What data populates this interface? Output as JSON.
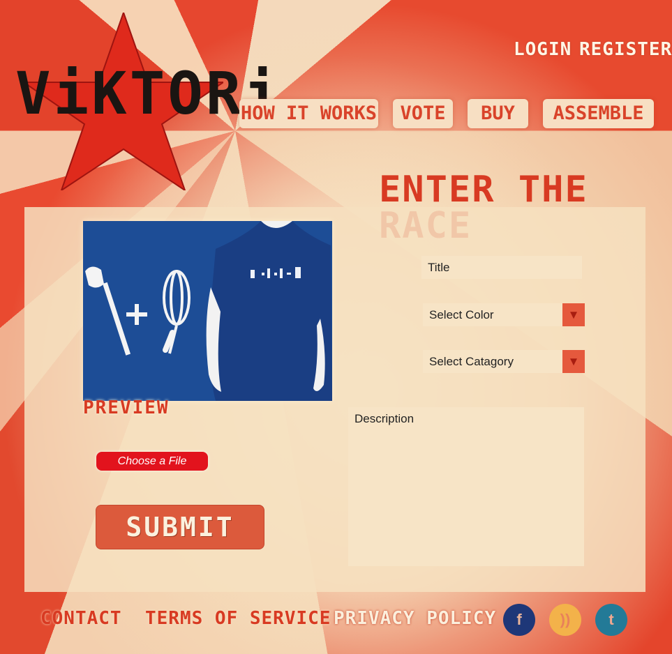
{
  "brand": {
    "logo_text": "ViKTORi"
  },
  "header": {
    "login_label": "LOGIN",
    "register_label": "REGISTER"
  },
  "nav": {
    "how_it_works": "HOW IT WORKS",
    "vote": "VOTE",
    "buy": "BUY",
    "assemble": "ASSEMBLE"
  },
  "main": {
    "title": "ENTER THE RACE",
    "preview_label": "PREVIEW",
    "choose_file_label": "Choose a File",
    "submit_label": "SUBMIT",
    "form": {
      "title_placeholder": "Title",
      "color_select": "Select Color",
      "category_select": "Select Catagory",
      "description_placeholder": "Description"
    }
  },
  "footer": {
    "contact": "CONTACT",
    "terms": "TERMS OF SERVICE",
    "privacy": "PRIVACY POLICY",
    "social": [
      {
        "icon": "facebook-icon",
        "glyph": "f",
        "color": "#1e3778"
      },
      {
        "icon": "rss-icon",
        "glyph": "))",
        "color": "#f3b24a"
      },
      {
        "icon": "twitter-icon",
        "glyph": "t",
        "color": "#237a97"
      }
    ]
  },
  "colors": {
    "accent_red": "#d83a22",
    "panel": "#f6e0c0",
    "shirt_blue": "#1d4d96"
  }
}
